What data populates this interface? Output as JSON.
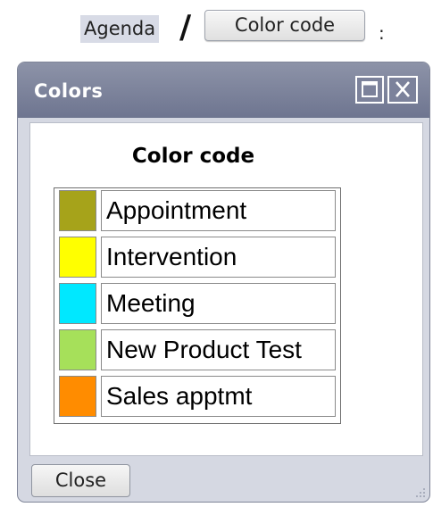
{
  "breadcrumb": {
    "agenda_label": "Agenda",
    "separator": "/",
    "color_code_button_label": "Color code",
    "trailing": ":"
  },
  "dialog": {
    "title": "Colors",
    "maximize_icon": "maximize-icon",
    "close_icon": "close-icon",
    "legend_title": "Color code",
    "close_button_label": "Close",
    "resize_icon": "resize-grip-icon"
  },
  "legend": {
    "items": [
      {
        "label": "Appointment",
        "color": "#a6a31a"
      },
      {
        "label": "Intervention",
        "color": "#ffff00"
      },
      {
        "label": "Meeting",
        "color": "#00e8ff"
      },
      {
        "label": "New Product Test",
        "color": "#a6e05a"
      },
      {
        "label": "Sales apptmt",
        "color": "#ff8c00"
      }
    ]
  },
  "colors": {
    "titlebar": "#7a8099",
    "dialog_bg": "#d5d8e2",
    "agenda_highlight": "#d8dbe6"
  }
}
